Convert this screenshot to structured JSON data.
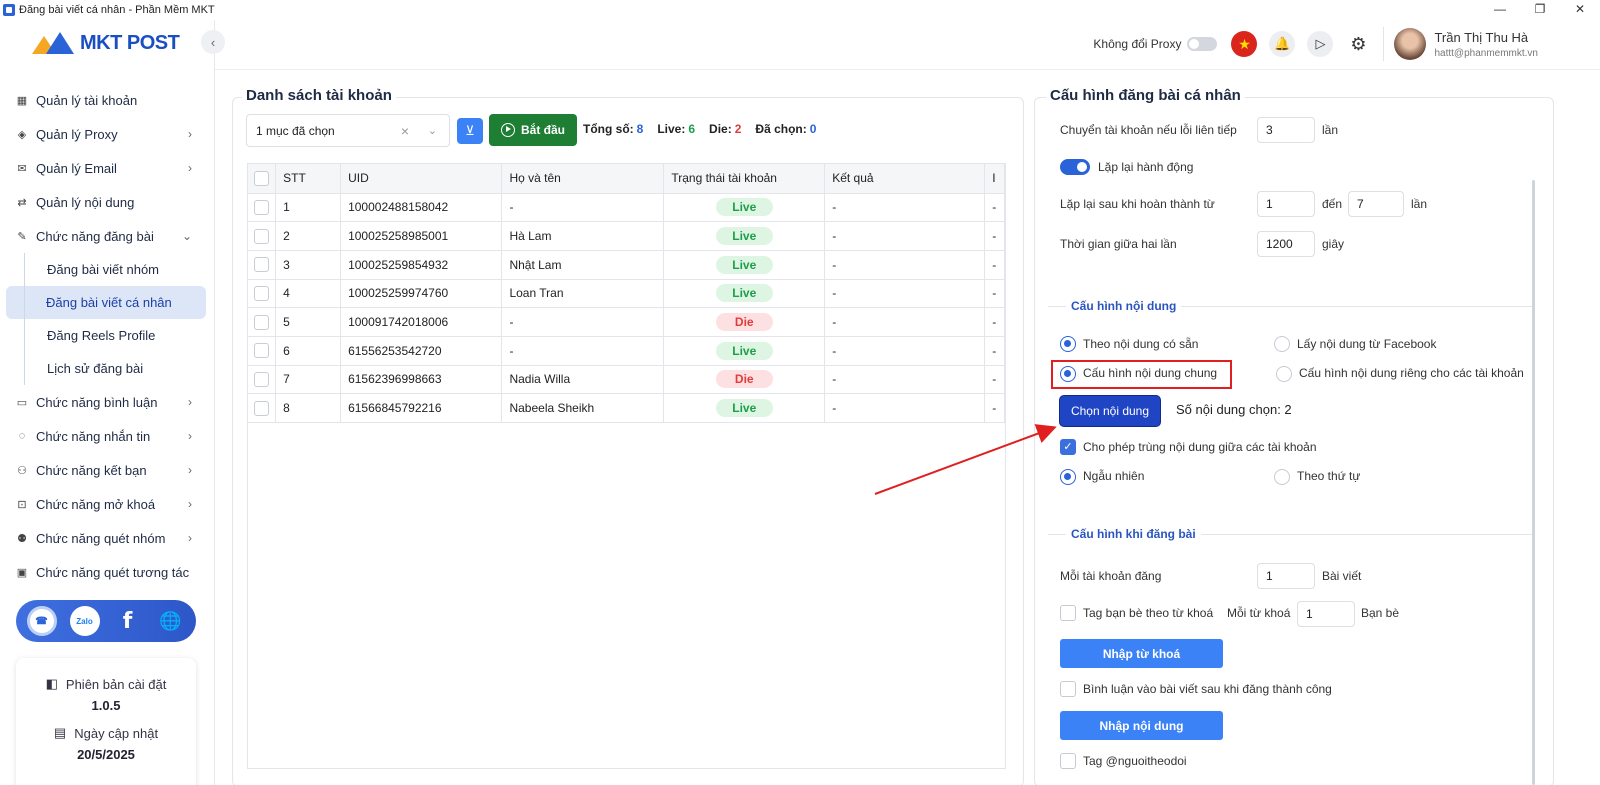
{
  "window": {
    "title": "Đăng bài viết cá nhân - Phần Mềm MKT",
    "min": "—",
    "restore": "❐",
    "close": "✕"
  },
  "brand": {
    "logo_text": "MKT POST"
  },
  "sidebar": {
    "collapse": "‹",
    "items": [
      {
        "label": "Quản lý tài khoản",
        "icon": "grid-icon"
      },
      {
        "label": "Quản lý Proxy",
        "icon": "layers-icon",
        "chevron": "›"
      },
      {
        "label": "Quản lý Email",
        "icon": "mail-icon",
        "chevron": "›"
      },
      {
        "label": "Quản lý nội dung",
        "icon": "shuffle-icon"
      },
      {
        "label": "Chức năng đăng bài",
        "icon": "edit-icon",
        "chevron": "⌄"
      }
    ],
    "sub_items": [
      "Đăng bài viết nhóm",
      "Đăng bài viết cá nhân",
      "Đăng Reels Profile",
      "Lịch sử đăng bài"
    ],
    "items2": [
      {
        "label": "Chức năng bình luận",
        "icon": "comment-icon",
        "chevron": "›"
      },
      {
        "label": "Chức năng nhắn tin",
        "icon": "chat-icon",
        "chevron": "›"
      },
      {
        "label": "Chức năng kết bạn",
        "icon": "add-friend-icon",
        "chevron": "›"
      },
      {
        "label": "Chức năng mở khoá",
        "icon": "lock-icon",
        "chevron": "›"
      },
      {
        "label": "Chức năng quét nhóm",
        "icon": "group-icon",
        "chevron": "›"
      },
      {
        "label": "Chức năng quét tương tác",
        "icon": "scan-icon"
      }
    ],
    "social": {
      "zalo": "Zalo",
      "fb": "f",
      "web": "🌐",
      "support": "☎"
    },
    "version_label": "Phiên bản cài đặt",
    "version_value": "1.0.5",
    "update_label": "Ngày cập nhật",
    "update_value": "20/5/2025"
  },
  "header": {
    "proxy_label": "Không đổi Proxy",
    "flag": "★",
    "bell": "🔔",
    "play": "▷",
    "gear": "⚙",
    "user_name": "Trần Thị Thu Hà",
    "user_email": "hattt@phanmemmkt.vn"
  },
  "accounts": {
    "title": "Danh sách tài khoản",
    "select_value": "1 mục đã chọn",
    "clear": "×",
    "dropdown": "⌄",
    "filter": "⊻",
    "start_label": "Bắt đầu",
    "stats": {
      "total_label": "Tổng số:",
      "total": "8",
      "live_label": "Live:",
      "live": "6",
      "die_label": "Die:",
      "die": "2",
      "selected_label": "Đã chọn:",
      "selected": "0"
    },
    "columns": [
      "STT",
      "UID",
      "Họ và tên",
      "Trạng thái tài khoản",
      "Kết quả",
      "I"
    ],
    "rows": [
      {
        "stt": "1",
        "uid": "100002488158042",
        "name": "-",
        "status": "Live",
        "result": "-",
        "extra": "-"
      },
      {
        "stt": "2",
        "uid": "100025258985001",
        "name": "Hà Lam",
        "status": "Live",
        "result": "-",
        "extra": "-"
      },
      {
        "stt": "3",
        "uid": "100025259854932",
        "name": "Nhật Lam",
        "status": "Live",
        "result": "-",
        "extra": "-"
      },
      {
        "stt": "4",
        "uid": "100025259974760",
        "name": "Loan Tran",
        "status": "Live",
        "result": "-",
        "extra": "-"
      },
      {
        "stt": "5",
        "uid": "100091742018006",
        "name": "-",
        "status": "Die",
        "result": "-",
        "extra": "-"
      },
      {
        "stt": "6",
        "uid": "61556253542720",
        "name": "-",
        "status": "Live",
        "result": "-",
        "extra": "-"
      },
      {
        "stt": "7",
        "uid": "61562396998663",
        "name": "Nadia Willa",
        "status": "Die",
        "result": "-",
        "extra": "-"
      },
      {
        "stt": "8",
        "uid": "61566845792216",
        "name": "Nabeela Sheikh",
        "status": "Live",
        "result": "-",
        "extra": "-"
      }
    ]
  },
  "config": {
    "title": "Cấu hình đăng bài cá nhân",
    "switch_label": "Chuyển tài khoản nếu lỗi liên tiếp",
    "switch_value": "3",
    "times": "lần",
    "repeat_label": "Lặp lại hành động",
    "repeat_on": true,
    "repeat_after_label": "Lặp lại sau khi hoàn thành từ",
    "repeat_from": "1",
    "to": "đến",
    "repeat_to": "7",
    "interval_label": "Thời gian giữa hai lần",
    "interval_value": "1200",
    "seconds": "giây",
    "content_section": "Cấu hình nội dung",
    "opt_available": "Theo nội dung có sẵn",
    "opt_facebook": "Lấy nội dung từ Facebook",
    "opt_common": "Cấu hình nội dung chung",
    "opt_separate": "Cấu hình nội dung riêng cho các tài khoản",
    "choose_btn": "Chọn nội dung",
    "count_label": "Số nội dung chọn: 2",
    "allow_dup": "Cho phép trùng nội dung giữa các tài khoản",
    "check_mark": "✓",
    "random": "Ngẫu nhiên",
    "sequential": "Theo thứ tự",
    "post_section": "Cấu hình khi đăng bài",
    "per_account_label": "Mỗi tài khoản đăng",
    "per_account_value": "1",
    "posts": "Bài viết",
    "tag_friends": "Tag bạn bè theo từ khoá",
    "per_keyword": "Mỗi từ khoá",
    "per_keyword_value": "1",
    "friends": "Bạn bè",
    "import_keywords": "Nhập từ khoá",
    "comment_after": "Bình luận vào bài viết sau khi đăng thành công",
    "import_content": "Nhập nội dung",
    "tag_follower": "Tag @nguoitheodoi"
  },
  "colors": {
    "primary": "#2a62d8",
    "start": "#1e7e34",
    "live": "#1e9e4a",
    "die": "#e23b3b",
    "highlight": "#e02020"
  }
}
